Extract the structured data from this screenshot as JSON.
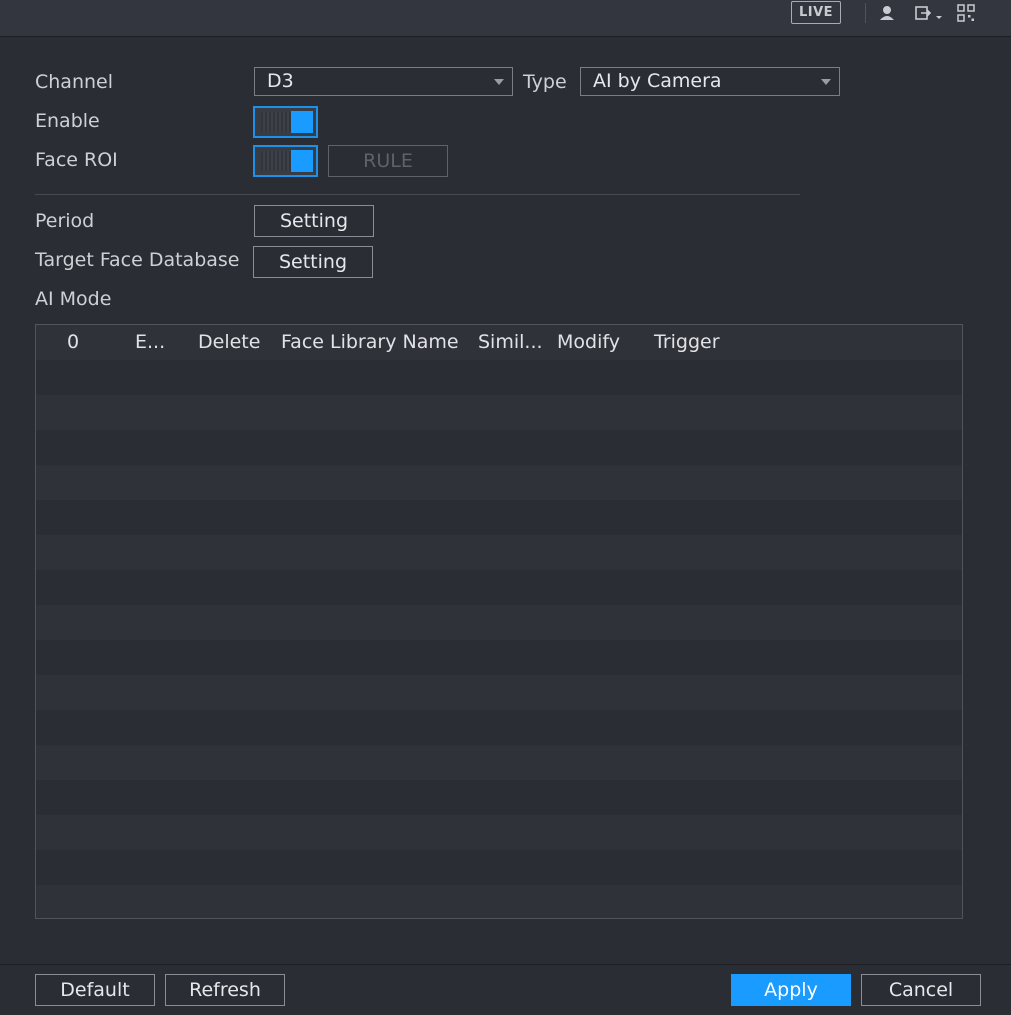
{
  "topbar": {
    "live_label": "LIVE",
    "icons": [
      "user-icon",
      "logout-icon",
      "qr-code-icon"
    ]
  },
  "form": {
    "channel_label": "Channel",
    "channel_value": "D3",
    "type_label": "Type",
    "type_value": "AI by Camera",
    "enable_label": "Enable",
    "enable_on": true,
    "face_roi_label": "Face ROI",
    "face_roi_on": true,
    "rule_button": "RULE",
    "period_label": "Period",
    "period_button": "Setting",
    "target_db_label": "Target Face Database",
    "target_db_button": "Setting",
    "ai_mode_label": "AI Mode"
  },
  "table": {
    "columns": [
      "0",
      "E...",
      "Delete",
      "Face Library Name",
      "Simil...",
      "Modify",
      "Trigger"
    ],
    "rows": []
  },
  "footer": {
    "default_button": "Default",
    "refresh_button": "Refresh",
    "apply_button": "Apply",
    "cancel_button": "Cancel"
  },
  "colors": {
    "accent": "#1a9bff",
    "background": "#2b2d35"
  }
}
